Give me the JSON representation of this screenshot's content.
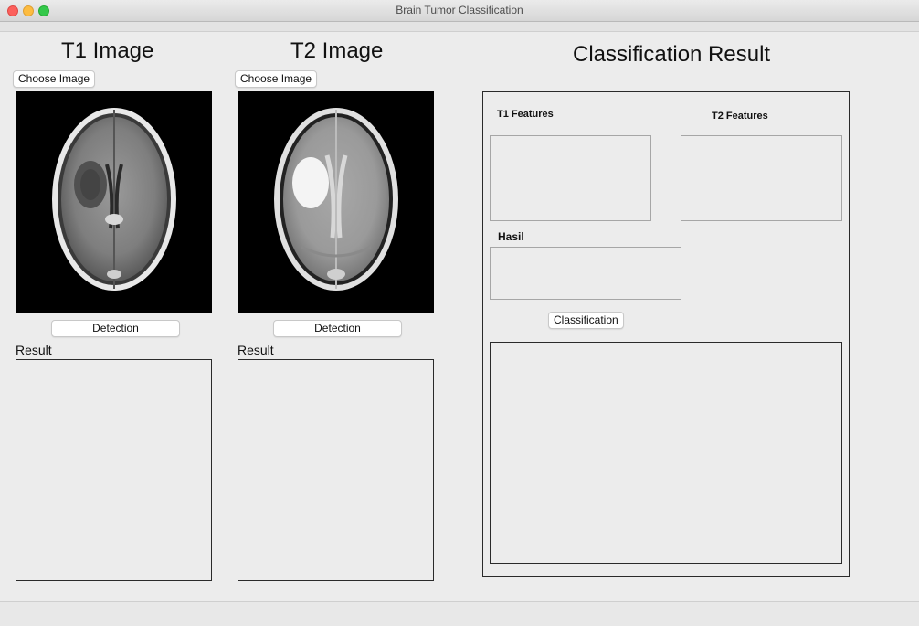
{
  "window": {
    "title": "Brain Tumor Classification"
  },
  "t1": {
    "heading": "T1 Image",
    "choose_label": "Choose Image",
    "detection_label": "Detection",
    "result_label": "Result"
  },
  "t2": {
    "heading": "T2 Image",
    "choose_label": "Choose Image",
    "detection_label": "Detection",
    "result_label": "Result"
  },
  "classification": {
    "heading": "Classification Result",
    "t1_features_label": "T1 Features",
    "t2_features_label": "T2 Features",
    "hasil_label": "Hasil",
    "button_label": "Classification"
  }
}
